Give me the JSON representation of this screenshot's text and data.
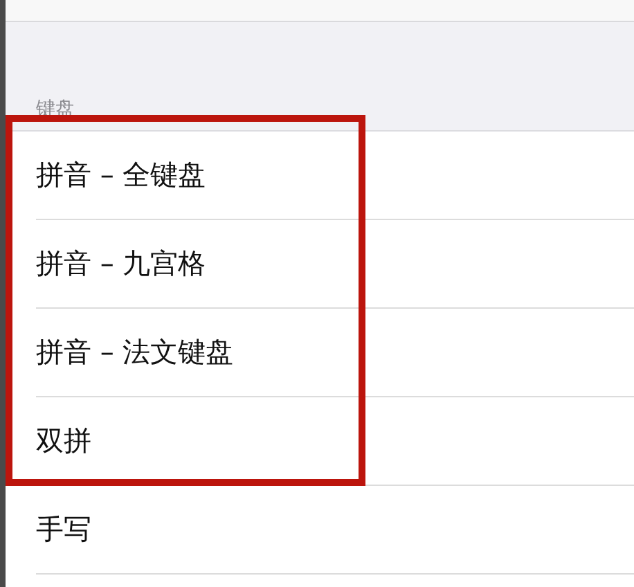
{
  "section": {
    "header": "键盘"
  },
  "items": [
    {
      "label": "拼音 – 全键盘",
      "highlighted": true
    },
    {
      "label": "拼音 – 九宫格",
      "highlighted": true
    },
    {
      "label": "拼音 – 法文键盘",
      "highlighted": true
    },
    {
      "label": "双拼",
      "highlighted": true
    },
    {
      "label": "手写"
    }
  ]
}
